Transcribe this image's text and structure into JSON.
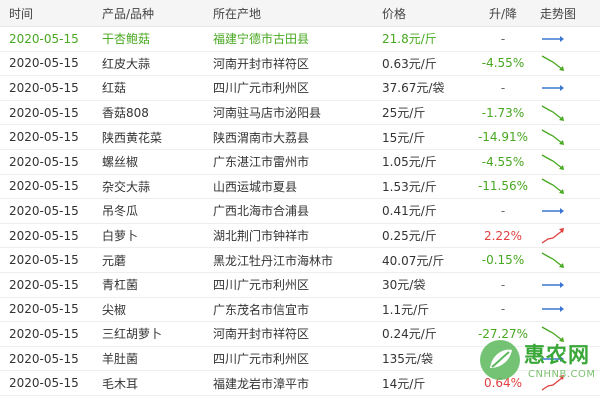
{
  "columns": {
    "time": "时间",
    "product": "产品/品种",
    "origin": "所在产地",
    "price": "价格",
    "change": "升/降",
    "trend": "走势图"
  },
  "rows": [
    {
      "time": "2020-05-15",
      "product": "干杏鲍菇",
      "origin": "福建宁德市古田县",
      "price": "21.8元/斤",
      "change": "-",
      "direction": "flat"
    },
    {
      "time": "2020-05-15",
      "product": "红皮大蒜",
      "origin": "河南开封市祥符区",
      "price": "0.63元/斤",
      "change": "-4.55%",
      "direction": "down"
    },
    {
      "time": "2020-05-15",
      "product": "红菇",
      "origin": "四川广元市利州区",
      "price": "37.67元/袋",
      "change": "-",
      "direction": "flat"
    },
    {
      "time": "2020-05-15",
      "product": "香菇808",
      "origin": "河南驻马店市泌阳县",
      "price": "25元/斤",
      "change": "-1.73%",
      "direction": "down"
    },
    {
      "time": "2020-05-15",
      "product": "陕西黄花菜",
      "origin": "陕西渭南市大荔县",
      "price": "15元/斤",
      "change": "-14.91%",
      "direction": "down"
    },
    {
      "time": "2020-05-15",
      "product": "螺丝椒",
      "origin": "广东湛江市雷州市",
      "price": "1.05元/斤",
      "change": "-4.55%",
      "direction": "down"
    },
    {
      "time": "2020-05-15",
      "product": "杂交大蒜",
      "origin": "山西运城市夏县",
      "price": "1.53元/斤",
      "change": "-11.56%",
      "direction": "down"
    },
    {
      "time": "2020-05-15",
      "product": "吊冬瓜",
      "origin": "广西北海市合浦县",
      "price": "0.41元/斤",
      "change": "-",
      "direction": "flat"
    },
    {
      "time": "2020-05-15",
      "product": "白萝卜",
      "origin": "湖北荆门市钟祥市",
      "price": "0.25元/斤",
      "change": "2.22%",
      "direction": "up"
    },
    {
      "time": "2020-05-15",
      "product": "元蘑",
      "origin": "黑龙江牡丹江市海林市",
      "price": "40.07元/斤",
      "change": "-0.15%",
      "direction": "down"
    },
    {
      "time": "2020-05-15",
      "product": "青杠菌",
      "origin": "四川广元市利州区",
      "price": "30元/袋",
      "change": "-",
      "direction": "flat"
    },
    {
      "time": "2020-05-15",
      "product": "尖椒",
      "origin": "广东茂名市信宜市",
      "price": "1.1元/斤",
      "change": "-",
      "direction": "flat"
    },
    {
      "time": "2020-05-15",
      "product": "三红胡萝卜",
      "origin": "河南开封市祥符区",
      "price": "0.24元/斤",
      "change": "-27.27%",
      "direction": "down"
    },
    {
      "time": "2020-05-15",
      "product": "羊肚菌",
      "origin": "四川广元市利州区",
      "price": "135元/袋",
      "change": "-",
      "direction": "flat"
    },
    {
      "time": "2020-05-15",
      "product": "毛木耳",
      "origin": "福建龙岩市漳平市",
      "price": "14元/斤",
      "change": "0.64%",
      "direction": "up"
    }
  ],
  "watermark": {
    "title": "惠农网",
    "url": "CNHNB.COM"
  },
  "colors": {
    "down": "#48a820",
    "up": "#e04040",
    "flat": "#3a78d0",
    "first_row": "#48a820"
  },
  "icons": {
    "flat": "arrow-right-icon",
    "down": "trend-down-icon",
    "up": "trend-up-icon"
  }
}
